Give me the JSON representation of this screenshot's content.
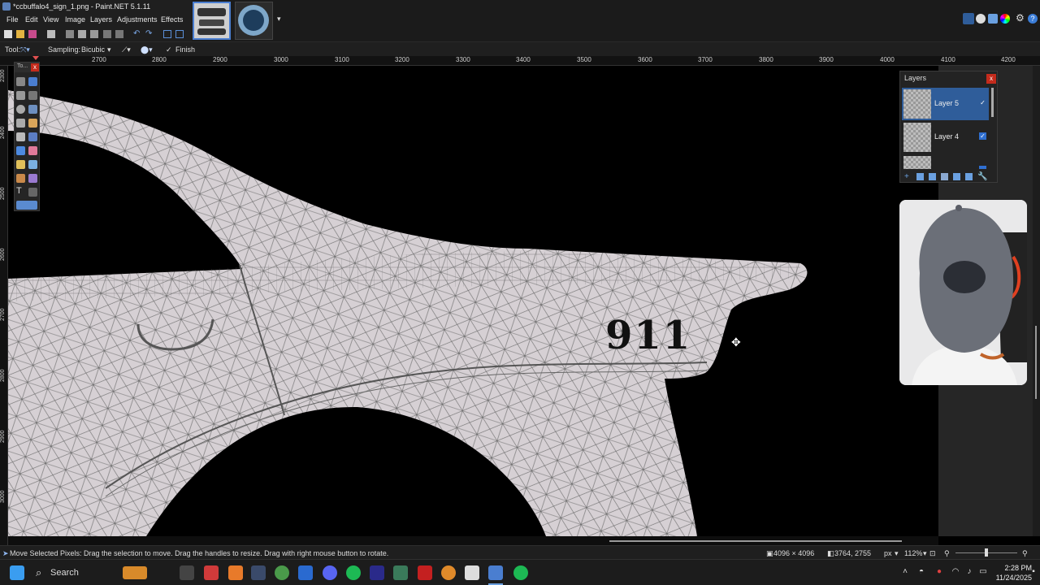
{
  "window": {
    "title": "*ccbuffalo4_sign_1.png - Paint.NET 5.1.11",
    "minimize": "—",
    "maximize": "☐",
    "close": "✕"
  },
  "menu": [
    "File",
    "Edit",
    "View",
    "Image",
    "Layers",
    "Adjustments",
    "Effects"
  ],
  "toolbar_icons": [
    "new-icon",
    "open-icon",
    "save-icon",
    "print-icon",
    "cut-icon",
    "copy-icon",
    "paste-icon",
    "crop-icon",
    "deselect-icon",
    "undo-icon",
    "redo-icon",
    "grid-icon",
    "ruler-icon"
  ],
  "thumbnails": [
    {
      "name": "thumbnail-car-template",
      "active": true
    },
    {
      "name": "thumbnail-logo",
      "active": false
    }
  ],
  "options": {
    "tool_label": "Tool:",
    "sampling_label": "Sampling:",
    "sampling_value": "Bicubic",
    "finish_label": "Finish"
  },
  "ruler_top": [
    "2700",
    "2800",
    "2900",
    "3000",
    "3100",
    "3200",
    "3300",
    "3400",
    "3500",
    "3600",
    "3700",
    "3800",
    "3900",
    "4000",
    "4100",
    "4200"
  ],
  "ruler_left": [
    "2300",
    "2400",
    "2500",
    "2600",
    "2700",
    "2800",
    "2900",
    "3000"
  ],
  "tools_window": {
    "title": "To...",
    "close": "x",
    "text_tool_glyph": "T"
  },
  "canvas": {
    "decal_text": "911"
  },
  "layers": {
    "title": "Layers",
    "close": "x",
    "items": [
      {
        "name": "Layer 5",
        "selected": true
      },
      {
        "name": "Layer 4",
        "selected": false
      }
    ]
  },
  "status": {
    "hint": "Move Selected Pixels: Drag the selection to move. Drag the handles to resize. Drag with right mouse button to rotate.",
    "image_size": "4096 × 4096",
    "cursor_pos": "3764, 2755",
    "units": "px",
    "zoom": "112%"
  },
  "taskbar": {
    "search_label": "Search",
    "time": "2:28 PM",
    "date": "11/24/2025"
  },
  "colors": {
    "accent": "#2f5d9a",
    "car_fill": "#d6d0d4",
    "mesh_line": "#5c5c5c"
  }
}
